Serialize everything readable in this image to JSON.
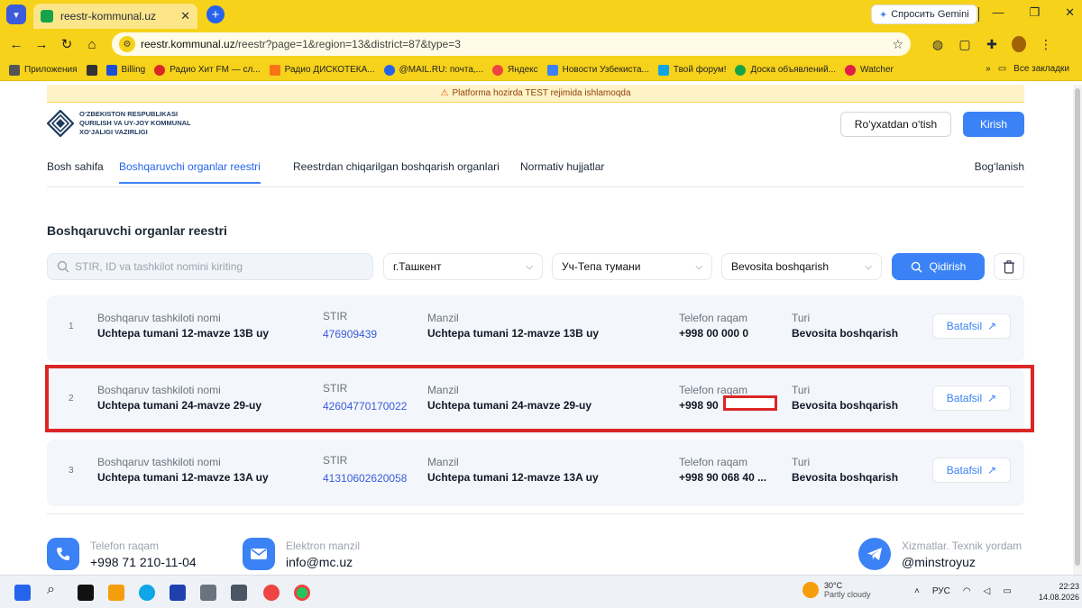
{
  "browser": {
    "tab_title": "reestr-kommunal.uz",
    "gemini_label": "Спросить Gemini",
    "url_host": "reestr.kommunal.uz",
    "url_path": "/reestr?page=1&region=13&district=87&type=3",
    "bookmarks": [
      "Приложения",
      "Billing",
      "Радио Хит FM — сл...",
      "Радио ДИСКОТЕКА...",
      "@MAIL.RU: почта,...",
      "Яндекс",
      "Новости Узбекиста...",
      "Твой форум!",
      "Доска объявлений...",
      "Watcher"
    ],
    "all_bookmarks_label": "Все закладки"
  },
  "banner": {
    "text": "Platforma hozirda TEST rejimida ishlamoqda"
  },
  "logo": {
    "line1": "O‘ZBEKISTON RESPUBLIKASI",
    "line2": "QURILISH VA UY-JOY KOMMUNAL",
    "line3": "XO‘JALIGI VAZIRLIGI"
  },
  "header": {
    "register_label": "Ro‘yxatdan o‘tish",
    "login_label": "Kirish"
  },
  "nav": {
    "home": "Bosh sahifa",
    "registry": "Boshqaruvchi organlar reestri",
    "excluded": "Reestrdan chiqarilgan boshqarish organlari",
    "normative": "Normativ hujjatlar",
    "contact": "Bog‘lanish"
  },
  "page": {
    "title": "Boshqaruvchi organlar reestri"
  },
  "filters": {
    "search_placeholder": "STIR, ID va tashkilot nomini kiriting",
    "region": "г.Ташкент",
    "district": "Уч-Тепа тумани",
    "type": "Bevosita boshqarish",
    "search_button": "Qidirish"
  },
  "columns": {
    "name": "Boshqaruv tashkiloti nomi",
    "stir": "STIR",
    "address": "Manzil",
    "phone": "Telefon raqam",
    "type": "Turi"
  },
  "rows": [
    {
      "num": "1",
      "name": "Uchtepa tumani 12-mavze 13B uy",
      "stir": "476909439",
      "address": "Uchtepa tumani 12-mavze 13B uy",
      "phone": "+998 00 000 0",
      "type": "Bevosita boshqarish",
      "detail": "Batafsil"
    },
    {
      "num": "2",
      "name": "Uchtepa tumani 24-mavze 29-uy",
      "stir": "42604770170022",
      "address": "Uchtepa tumani 24-mavze 29-uy",
      "phone": "+998 90",
      "type": "Bevosita boshqarish",
      "detail": "Batafsil"
    },
    {
      "num": "3",
      "name": "Uchtepa tumani 12-mavze 13A uy",
      "stir": "41310602620058",
      "address": "Uchtepa tumani 12-mavze 13A uy",
      "phone": "+998 90 068 40 ...",
      "type": "Bevosita boshqarish",
      "detail": "Batafsil"
    }
  ],
  "footer": {
    "phone_label": "Telefon raqam",
    "phone": "+998 71 210-11-04",
    "email_label": "Elektron manzil",
    "email": "info@mc.uz",
    "support_label": "Xizmatlar. Texnik yordam",
    "support": "@minstroyuz"
  },
  "taskbar": {
    "temperature": "30°C",
    "weather": "Partly cloudy",
    "lang": "РУС",
    "time": "22:23",
    "date": "14.08.2026"
  },
  "colors": {
    "accent": "#3b82f6",
    "highlight": "#dc2626",
    "chrome": "#f6d21a"
  }
}
